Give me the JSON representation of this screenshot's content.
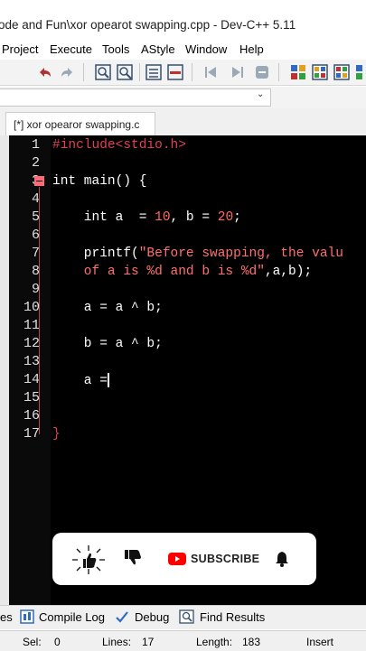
{
  "window": {
    "title": "ode and Fun\\xor opearot swapping.cpp - Dev-C++ 5.11"
  },
  "menu": [
    "Project",
    "Execute",
    "Tools",
    "AStyle",
    "Window",
    "Help"
  ],
  "tab": {
    "label": "[*] xor opearor swapping.c"
  },
  "editor": {
    "line_numbers": [
      "1",
      "2",
      "3",
      "4",
      "5",
      "6",
      "7",
      "8",
      "9",
      "10",
      "11",
      "12",
      "13",
      "14",
      "15",
      "16",
      "17"
    ],
    "lines": {
      "l1": "#include<stdio.h>",
      "l3a": "int",
      "l3b": " main() {",
      "l5a": "    int a  = ",
      "l5b": "10",
      "l5c": ", b = ",
      "l5d": "20",
      "l5e": ";",
      "l7a": "    printf(",
      "l7b": "\"Before swapping, the valu",
      "l8a": "    of a is %d and b is %d\"",
      "l8b": ",a,b);",
      "l10": "    a = a ^ b;",
      "l12": "    b = a ^ b;",
      "l14": "    a =",
      "l17": "}"
    }
  },
  "overlay": {
    "subscribe_label": "SUBSCRIBE"
  },
  "bottom_tabs": {
    "t0": "es",
    "t1": "Compile Log",
    "t2": "Debug",
    "t3": "Find Results"
  },
  "status": {
    "sel_label": "Sel:",
    "sel_value": "0",
    "lines_label": "Lines:",
    "lines_value": "17",
    "length_label": "Length:",
    "length_value": "183",
    "mode": "Insert"
  },
  "colors": {
    "editor_bg": "#000000",
    "youtube_red": "#ff0000",
    "fold_marker": "#ff6a78"
  }
}
